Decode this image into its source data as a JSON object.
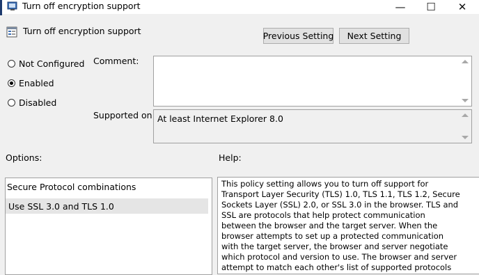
{
  "window": {
    "title": "Turn off encryption support",
    "minimize_glyph": "—",
    "maximize_glyph": "☐",
    "close_glyph": "✕"
  },
  "header": {
    "policy_name": "Turn off encryption support",
    "previous_label": "Previous Setting",
    "next_label": "Next Setting"
  },
  "state": {
    "options": [
      {
        "label": "Not Configured",
        "checked": false
      },
      {
        "label": "Enabled",
        "checked": true
      },
      {
        "label": "Disabled",
        "checked": false
      }
    ]
  },
  "comment": {
    "label": "Comment:",
    "value": ""
  },
  "supported": {
    "label": "Supported on:",
    "value": "At least Internet Explorer 8.0"
  },
  "options_panel": {
    "label": "Options:",
    "heading": "Secure Protocol combinations",
    "selected_value": "Use SSL 3.0 and TLS 1.0"
  },
  "help_panel": {
    "label": "Help:",
    "text": "This policy setting allows you to turn off support for Transport Layer Security (TLS) 1.0, TLS 1.1, TLS 1.2, Secure Sockets Layer (SSL) 2.0, or SSL 3.0 in the browser. TLS and SSL are protocols that help protect communication between the browser and the target server. When the browser attempts to set up a protected communication with the target server, the browser and server negotiate which protocol and version to use. The browser and server attempt to match each other's list of supported protocols and versions, and they select the most preferred match."
  },
  "icons": {
    "title_icon": "policy-app-icon",
    "header_icon": "policy-setting-icon"
  }
}
